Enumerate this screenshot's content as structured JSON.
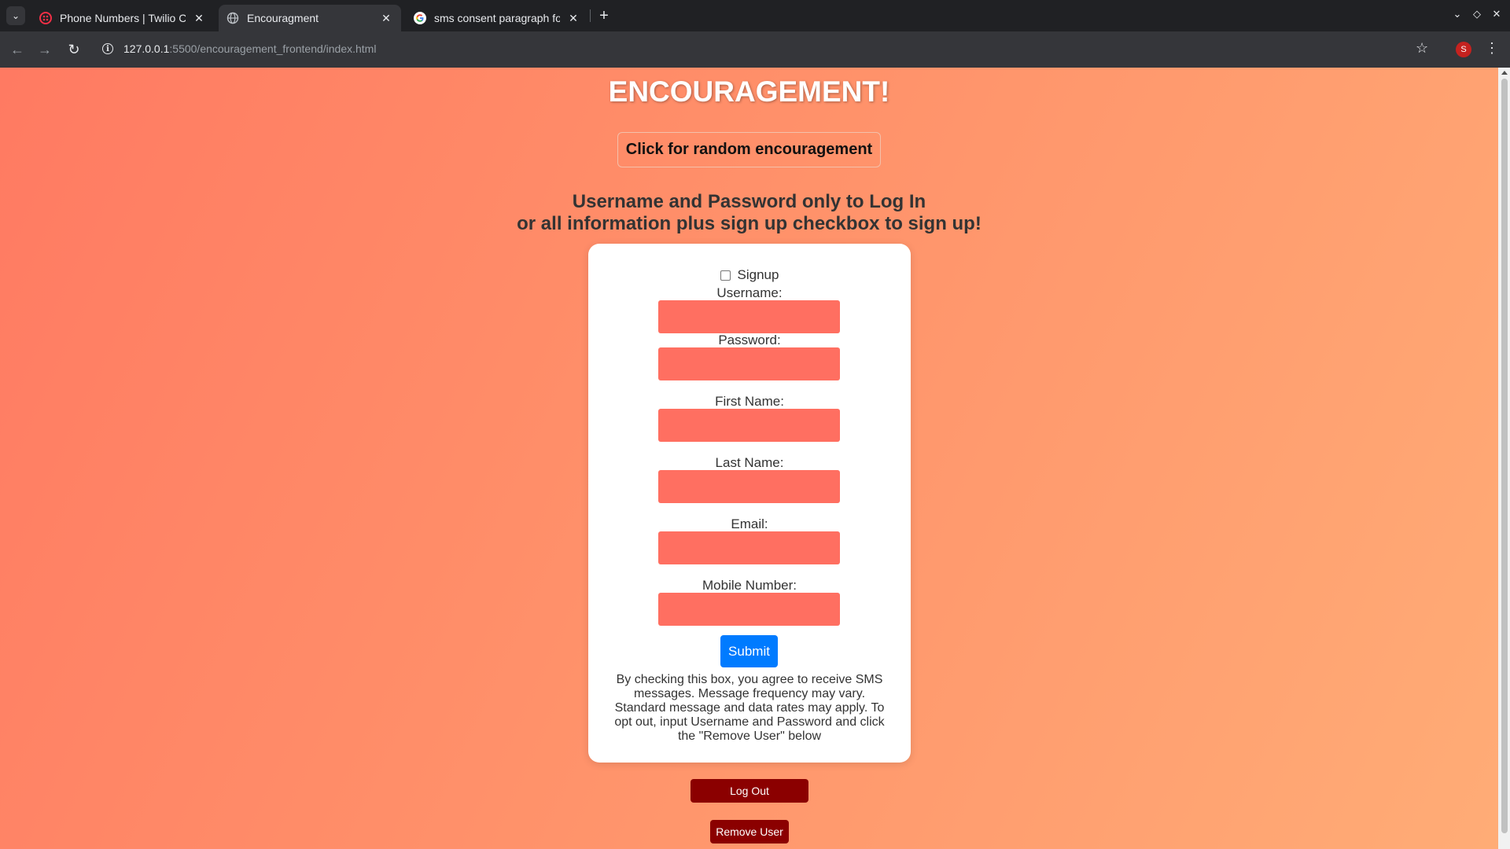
{
  "browser": {
    "tabs": [
      {
        "title": "Phone Numbers | Twilio Co",
        "favicon": "twilio-icon",
        "color": "#f22f46"
      },
      {
        "title": "Encouragment",
        "favicon": "globe-icon",
        "active": true
      },
      {
        "title": "sms consent paragraph for",
        "favicon": "google-icon"
      }
    ],
    "url_host": "127.0.0.1",
    "url_path": ":5500/encouragement_frontend/index.html",
    "profile_initial": "S"
  },
  "page": {
    "title": "ENCOURAGEMENT!",
    "random_button": "Click for random encouragement",
    "instructions_line1": "Username and Password only to Log In",
    "instructions_line2": "or all information plus sign up checkbox to sign up!",
    "form": {
      "signup_label": "Signup",
      "fields": [
        {
          "label": "Username:",
          "value": ""
        },
        {
          "label": "Password:",
          "value": ""
        },
        {
          "label": "First Name:",
          "value": ""
        },
        {
          "label": "Last Name:",
          "value": ""
        },
        {
          "label": "Email:",
          "value": ""
        },
        {
          "label": "Mobile Number:",
          "value": ""
        }
      ],
      "submit_label": "Submit",
      "consent_text": "By checking this box, you agree to receive SMS messages. Message frequency may vary. Standard message and data rates may apply. To opt out, input Username and Password and click the \"Remove User\" below"
    },
    "logout_label": "Log Out",
    "remove_label": "Remove User"
  },
  "colors": {
    "gradient_start": "#ff7a62",
    "gradient_end": "#ffac76",
    "field_bg": "#ff6f61",
    "submit_bg": "#007bff",
    "danger_bg": "#8b0000"
  }
}
